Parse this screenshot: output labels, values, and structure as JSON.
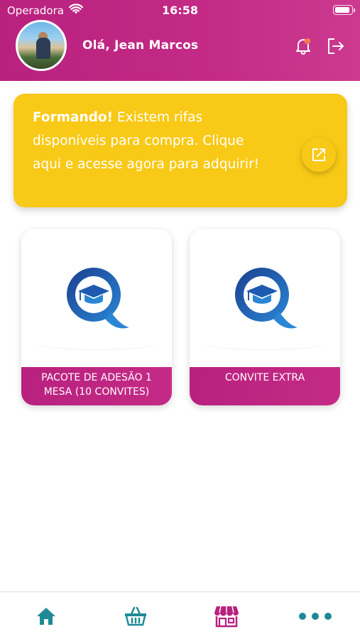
{
  "status_bar": {
    "carrier": "Operadora",
    "time": "16:58"
  },
  "header": {
    "greeting": "Olá, Jean Marcos"
  },
  "promo": {
    "bold": "Formando!",
    "text": " Existem rifas disponíveis para compra. Clique aqui e acesse agora para adquirir!"
  },
  "products": [
    {
      "label": "PACOTE DE ADESÃO 1 MESA (10 CONVITES)"
    },
    {
      "label": "CONVITE EXTRA"
    }
  ],
  "tabbar": {
    "items": [
      "home-icon",
      "basket-icon",
      "store-icon",
      "more-icon"
    ]
  },
  "colors": {
    "primary": "#b9217f",
    "promo_bg": "#f8c916",
    "tab_icon": "#1f8a95",
    "tab_active": "#b9217f"
  }
}
